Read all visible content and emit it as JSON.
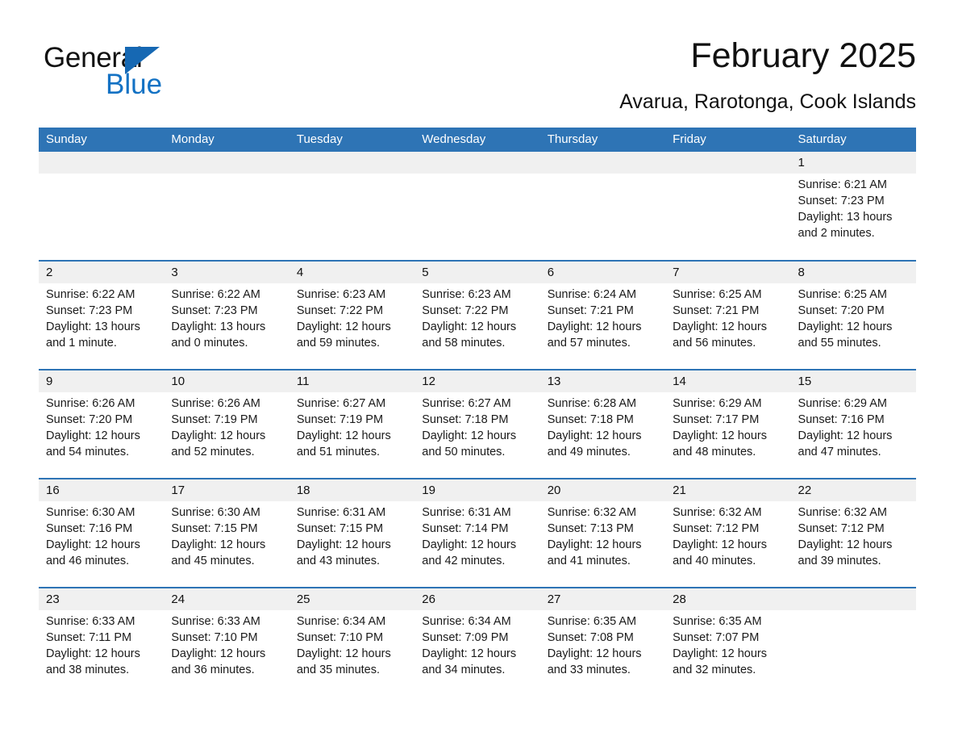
{
  "brand": {
    "word_one": "General",
    "word_two": "Blue",
    "triangle_icon": "blue-triangle-icon",
    "accent_color": "#1372c4"
  },
  "header": {
    "title": "February 2025",
    "subtitle": "Avarua, Rarotonga, Cook Islands",
    "header_bg_color": "#2e74b5",
    "daynum_bg_color": "#f0f0f0"
  },
  "weekdays": [
    "Sunday",
    "Monday",
    "Tuesday",
    "Wednesday",
    "Thursday",
    "Friday",
    "Saturday"
  ],
  "weeks": [
    [
      {
        "day": "",
        "sunrise": "",
        "sunset": "",
        "daylight": ""
      },
      {
        "day": "",
        "sunrise": "",
        "sunset": "",
        "daylight": ""
      },
      {
        "day": "",
        "sunrise": "",
        "sunset": "",
        "daylight": ""
      },
      {
        "day": "",
        "sunrise": "",
        "sunset": "",
        "daylight": ""
      },
      {
        "day": "",
        "sunrise": "",
        "sunset": "",
        "daylight": ""
      },
      {
        "day": "",
        "sunrise": "",
        "sunset": "",
        "daylight": ""
      },
      {
        "day": "1",
        "sunrise": "Sunrise: 6:21 AM",
        "sunset": "Sunset: 7:23 PM",
        "daylight": "Daylight: 13 hours and 2 minutes."
      }
    ],
    [
      {
        "day": "2",
        "sunrise": "Sunrise: 6:22 AM",
        "sunset": "Sunset: 7:23 PM",
        "daylight": "Daylight: 13 hours and 1 minute."
      },
      {
        "day": "3",
        "sunrise": "Sunrise: 6:22 AM",
        "sunset": "Sunset: 7:23 PM",
        "daylight": "Daylight: 13 hours and 0 minutes."
      },
      {
        "day": "4",
        "sunrise": "Sunrise: 6:23 AM",
        "sunset": "Sunset: 7:22 PM",
        "daylight": "Daylight: 12 hours and 59 minutes."
      },
      {
        "day": "5",
        "sunrise": "Sunrise: 6:23 AM",
        "sunset": "Sunset: 7:22 PM",
        "daylight": "Daylight: 12 hours and 58 minutes."
      },
      {
        "day": "6",
        "sunrise": "Sunrise: 6:24 AM",
        "sunset": "Sunset: 7:21 PM",
        "daylight": "Daylight: 12 hours and 57 minutes."
      },
      {
        "day": "7",
        "sunrise": "Sunrise: 6:25 AM",
        "sunset": "Sunset: 7:21 PM",
        "daylight": "Daylight: 12 hours and 56 minutes."
      },
      {
        "day": "8",
        "sunrise": "Sunrise: 6:25 AM",
        "sunset": "Sunset: 7:20 PM",
        "daylight": "Daylight: 12 hours and 55 minutes."
      }
    ],
    [
      {
        "day": "9",
        "sunrise": "Sunrise: 6:26 AM",
        "sunset": "Sunset: 7:20 PM",
        "daylight": "Daylight: 12 hours and 54 minutes."
      },
      {
        "day": "10",
        "sunrise": "Sunrise: 6:26 AM",
        "sunset": "Sunset: 7:19 PM",
        "daylight": "Daylight: 12 hours and 52 minutes."
      },
      {
        "day": "11",
        "sunrise": "Sunrise: 6:27 AM",
        "sunset": "Sunset: 7:19 PM",
        "daylight": "Daylight: 12 hours and 51 minutes."
      },
      {
        "day": "12",
        "sunrise": "Sunrise: 6:27 AM",
        "sunset": "Sunset: 7:18 PM",
        "daylight": "Daylight: 12 hours and 50 minutes."
      },
      {
        "day": "13",
        "sunrise": "Sunrise: 6:28 AM",
        "sunset": "Sunset: 7:18 PM",
        "daylight": "Daylight: 12 hours and 49 minutes."
      },
      {
        "day": "14",
        "sunrise": "Sunrise: 6:29 AM",
        "sunset": "Sunset: 7:17 PM",
        "daylight": "Daylight: 12 hours and 48 minutes."
      },
      {
        "day": "15",
        "sunrise": "Sunrise: 6:29 AM",
        "sunset": "Sunset: 7:16 PM",
        "daylight": "Daylight: 12 hours and 47 minutes."
      }
    ],
    [
      {
        "day": "16",
        "sunrise": "Sunrise: 6:30 AM",
        "sunset": "Sunset: 7:16 PM",
        "daylight": "Daylight: 12 hours and 46 minutes."
      },
      {
        "day": "17",
        "sunrise": "Sunrise: 6:30 AM",
        "sunset": "Sunset: 7:15 PM",
        "daylight": "Daylight: 12 hours and 45 minutes."
      },
      {
        "day": "18",
        "sunrise": "Sunrise: 6:31 AM",
        "sunset": "Sunset: 7:15 PM",
        "daylight": "Daylight: 12 hours and 43 minutes."
      },
      {
        "day": "19",
        "sunrise": "Sunrise: 6:31 AM",
        "sunset": "Sunset: 7:14 PM",
        "daylight": "Daylight: 12 hours and 42 minutes."
      },
      {
        "day": "20",
        "sunrise": "Sunrise: 6:32 AM",
        "sunset": "Sunset: 7:13 PM",
        "daylight": "Daylight: 12 hours and 41 minutes."
      },
      {
        "day": "21",
        "sunrise": "Sunrise: 6:32 AM",
        "sunset": "Sunset: 7:12 PM",
        "daylight": "Daylight: 12 hours and 40 minutes."
      },
      {
        "day": "22",
        "sunrise": "Sunrise: 6:32 AM",
        "sunset": "Sunset: 7:12 PM",
        "daylight": "Daylight: 12 hours and 39 minutes."
      }
    ],
    [
      {
        "day": "23",
        "sunrise": "Sunrise: 6:33 AM",
        "sunset": "Sunset: 7:11 PM",
        "daylight": "Daylight: 12 hours and 38 minutes."
      },
      {
        "day": "24",
        "sunrise": "Sunrise: 6:33 AM",
        "sunset": "Sunset: 7:10 PM",
        "daylight": "Daylight: 12 hours and 36 minutes."
      },
      {
        "day": "25",
        "sunrise": "Sunrise: 6:34 AM",
        "sunset": "Sunset: 7:10 PM",
        "daylight": "Daylight: 12 hours and 35 minutes."
      },
      {
        "day": "26",
        "sunrise": "Sunrise: 6:34 AM",
        "sunset": "Sunset: 7:09 PM",
        "daylight": "Daylight: 12 hours and 34 minutes."
      },
      {
        "day": "27",
        "sunrise": "Sunrise: 6:35 AM",
        "sunset": "Sunset: 7:08 PM",
        "daylight": "Daylight: 12 hours and 33 minutes."
      },
      {
        "day": "28",
        "sunrise": "Sunrise: 6:35 AM",
        "sunset": "Sunset: 7:07 PM",
        "daylight": "Daylight: 12 hours and 32 minutes."
      },
      {
        "day": "",
        "sunrise": "",
        "sunset": "",
        "daylight": ""
      }
    ]
  ]
}
